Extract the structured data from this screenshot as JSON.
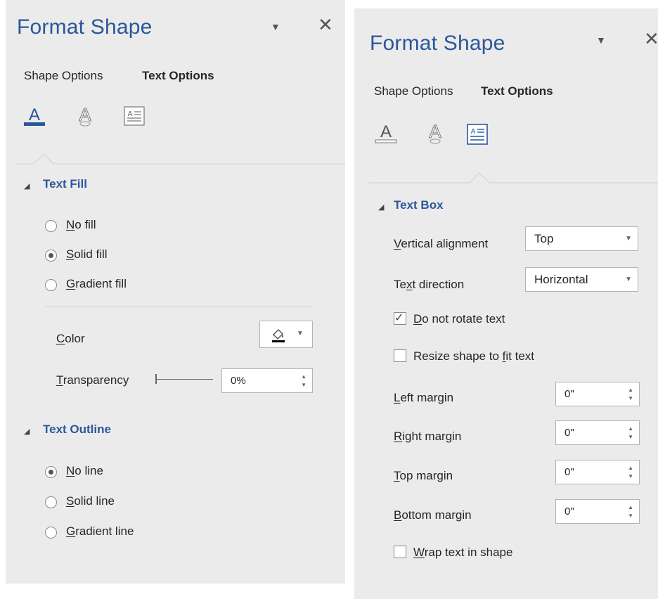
{
  "left_panel": {
    "title": "Format Shape",
    "tabs": [
      {
        "label": "Shape Options"
      },
      {
        "label": "Text Options"
      }
    ],
    "icons": [
      "text-fill-outline-icon",
      "text-effects-icon",
      "textbox-icon"
    ],
    "active_icon": "text-fill-outline-icon",
    "text_fill": {
      "heading": "Text Fill",
      "options": [
        {
          "pre": "",
          "key": "N",
          "post": "o fill",
          "checked": false
        },
        {
          "pre": "",
          "key": "S",
          "post": "olid fill",
          "checked": true
        },
        {
          "pre": "",
          "key": "G",
          "post": "radient fill",
          "checked": false
        }
      ],
      "color_label_key": "C",
      "color_label_rest": "olor",
      "transparency_label_key": "T",
      "transparency_label_rest": "ransparency",
      "transparency_value": "0%",
      "fill_color": "#000000"
    },
    "text_outline": {
      "heading": "Text Outline",
      "options": [
        {
          "pre": "",
          "key": "N",
          "post": "o line",
          "checked": true
        },
        {
          "pre": "",
          "key": "S",
          "post": "olid line",
          "checked": false
        },
        {
          "pre": "",
          "key": "G",
          "post": "radient line",
          "checked": false
        }
      ]
    }
  },
  "right_panel": {
    "title": "Format Shape",
    "tabs": [
      {
        "label": "Shape Options"
      },
      {
        "label": "Text Options"
      }
    ],
    "icons": [
      "text-fill-outline-icon",
      "text-effects-icon",
      "textbox-icon"
    ],
    "active_icon": "textbox-icon",
    "text_box": {
      "heading": "Text Box",
      "vertical_alignment": {
        "key": "V",
        "rest": "ertical alignment",
        "value": "Top"
      },
      "text_direction": {
        "pre": "Te",
        "key": "x",
        "rest": "t direction",
        "value": "Horizontal"
      },
      "do_not_rotate": {
        "key": "D",
        "rest": "o not rotate text",
        "checked": true
      },
      "resize_shape": {
        "pre": "Resize shape to ",
        "key": "f",
        "rest": "it text",
        "checked": false
      },
      "margins": [
        {
          "key": "L",
          "rest": "eft margin",
          "value": "0\""
        },
        {
          "key": "R",
          "rest": "ight margin",
          "value": "0\""
        },
        {
          "key": "T",
          "rest": "op margin",
          "value": "0\""
        },
        {
          "key": "B",
          "rest": "ottom margin",
          "value": "0\""
        }
      ],
      "wrap_text": {
        "key": "W",
        "rest": "rap text in shape",
        "checked": false
      }
    }
  },
  "colors": {
    "accent": "#2b579a",
    "panel_bg": "#ebebeb"
  }
}
